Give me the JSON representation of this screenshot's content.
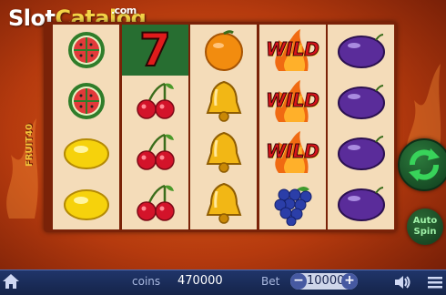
{
  "watermark": {
    "slot": "Slot",
    "catalog": "Catalog",
    "com": ".com"
  },
  "game_logo": "FRUIT40",
  "reels": [
    [
      "watermelon",
      "watermelon",
      "lemon",
      "lemon"
    ],
    [
      "seven",
      "cherries",
      "cherries",
      "cherries"
    ],
    [
      "orange",
      "bell",
      "bell",
      "bell"
    ],
    [
      "wild",
      "wild",
      "wild",
      "grapes"
    ],
    [
      "plum",
      "plum",
      "plum",
      "plum"
    ]
  ],
  "highlighted_cell": {
    "reel": 2,
    "row": 1
  },
  "symbol_text": {
    "seven": "7",
    "wild": "WILD"
  },
  "buttons": {
    "spin_icon": "refresh-arrows-icon",
    "auto_spin": "Auto Spin"
  },
  "bottom_bar": {
    "coins_label": "coins",
    "coins_value": "470000",
    "bet_label": "Bet",
    "bet_value": "10000",
    "minus": "−",
    "plus": "+"
  },
  "colors": {
    "reel_bg": "#f4dcb9",
    "highlight": "#276e31",
    "bar": "#1c2e5b",
    "accent_green": "#2ea84a"
  }
}
